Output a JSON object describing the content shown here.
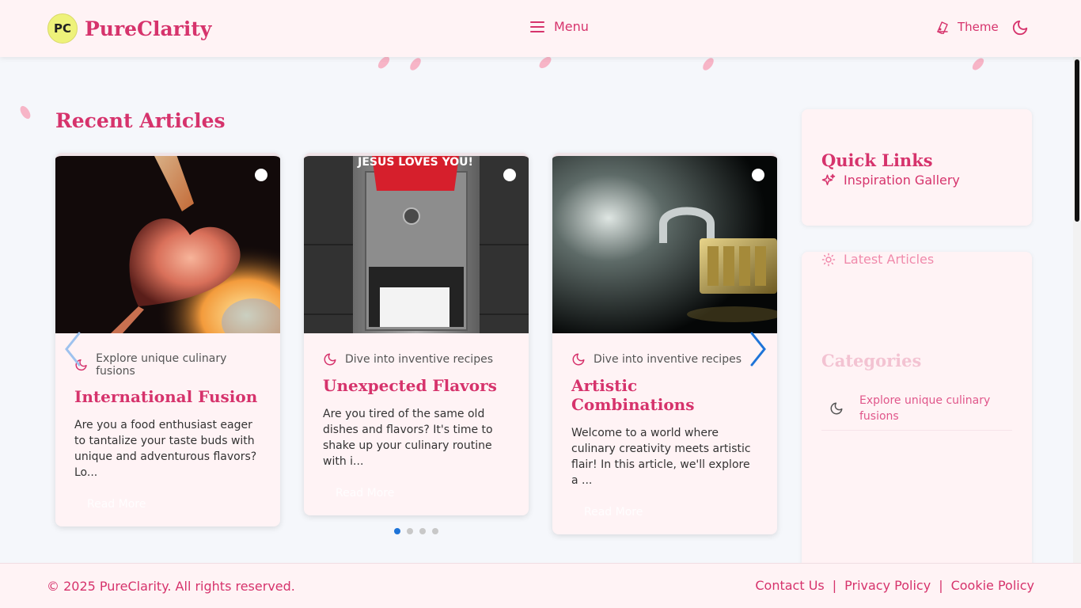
{
  "header": {
    "logo_badge": "PC",
    "brand": "PureClarity",
    "menu_label": "Menu",
    "theme_label": "Theme"
  },
  "main": {
    "section_title": "Recent Articles",
    "cards": [
      {
        "category": "Explore unique culinary fusions",
        "title": "International Fusion",
        "excerpt": "Are you a food enthusiast eager to tantalize your taste buds with unique and adventurous flavors? Lo...",
        "read_more": "Read More",
        "image": "glowing-glass-heart"
      },
      {
        "category": "Dive into inventive recipes",
        "title": "Unexpected Flavors",
        "excerpt": "Are you tired of the same old dishes and flavors? It's time to shake up your culinary routine with i...",
        "read_more": "Read More",
        "image": "toilet-paper-dispenser",
        "image_sign": "JESUS LOVES YOU!"
      },
      {
        "category": "Dive into inventive recipes",
        "title": "Artistic Combinations",
        "excerpt": "Welcome to a world where culinary creativity meets artistic flair! In this article, we'll explore a ...",
        "read_more": "Read More",
        "image": "combination-padlock"
      }
    ],
    "carousel": {
      "pages": 4,
      "active_page": 1
    }
  },
  "sidebar": {
    "quick_links_title": "Quick Links",
    "quick_links": [
      "Inspiration Gallery"
    ],
    "latest_articles_label": "Latest Articles",
    "categories_title": "Categories",
    "categories": [
      "Explore unique culinary fusions"
    ]
  },
  "footer": {
    "copyright": "© 2025 PureClarity. All rights reserved.",
    "links": [
      "Contact Us",
      "Privacy Policy",
      "Cookie Policy"
    ],
    "separator": "|"
  },
  "colors": {
    "accent": "#d6336c",
    "background": "#f5f7fb",
    "surface": "#fff3f5",
    "arrow": "#1e74d8"
  }
}
